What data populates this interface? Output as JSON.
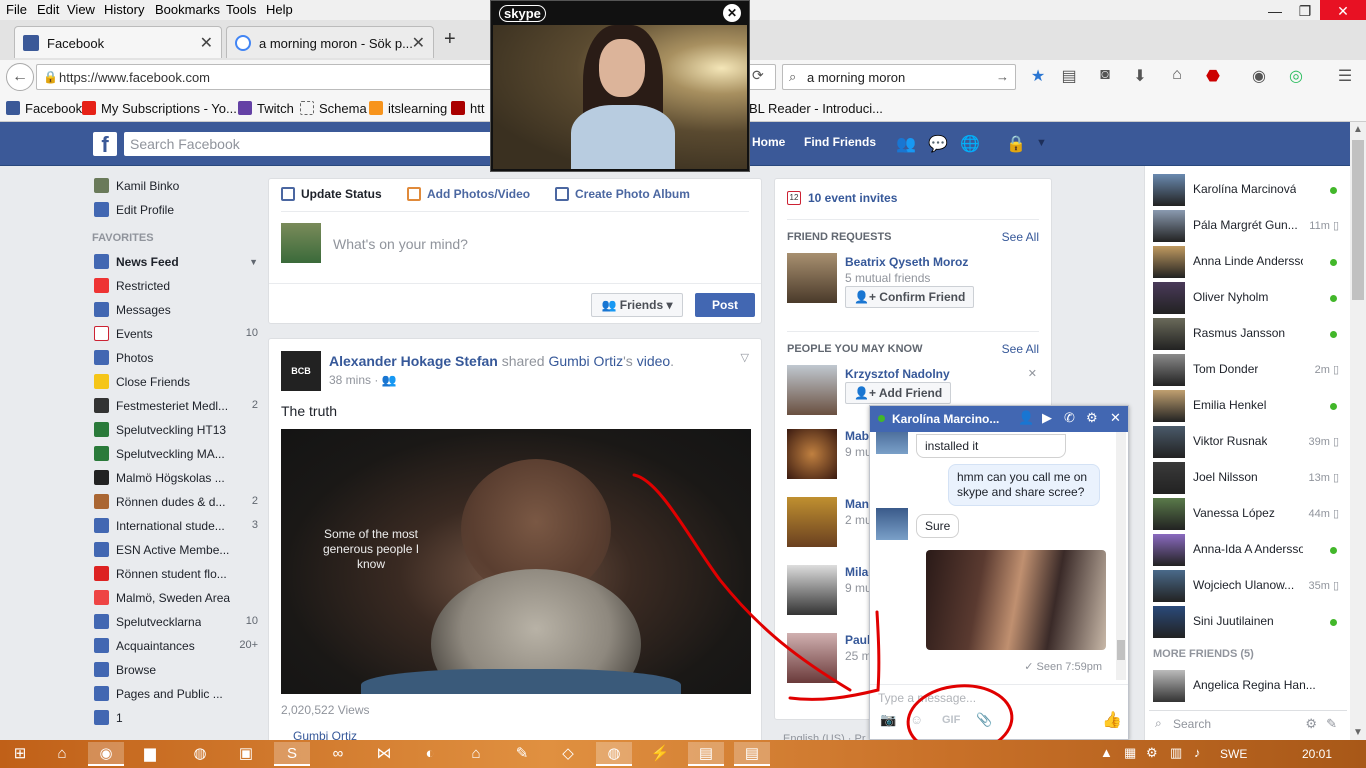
{
  "browser": {
    "menu": [
      "File",
      "Edit",
      "View",
      "History",
      "Bookmarks",
      "Tools",
      "Help"
    ],
    "tabs": [
      {
        "label": "Facebook",
        "active": true
      },
      {
        "label": "a morning moron - Sök p...",
        "active": false
      }
    ],
    "url": "https://www.facebook.com",
    "search_query": "a morning moron",
    "bookmarks": [
      "Facebook",
      "My Subscriptions - Yo...",
      "Twitch",
      "Schema",
      "itslearning",
      "htt",
      "BL Reader - Introduci..."
    ]
  },
  "skype": {
    "logo": "skype",
    "close": "✕"
  },
  "fb_header": {
    "search_placeholder": "Search Facebook",
    "home": "Home",
    "find_friends": "Find Friends"
  },
  "left_nav": {
    "user": "Kamil Binko",
    "edit_profile": "Edit Profile",
    "favorites_heading": "FAVORITES",
    "items": [
      {
        "label": "News Feed",
        "count": ""
      },
      {
        "label": "Restricted",
        "count": ""
      },
      {
        "label": "Messages",
        "count": ""
      },
      {
        "label": "Events",
        "count": "10"
      },
      {
        "label": "Photos",
        "count": ""
      },
      {
        "label": "Close Friends",
        "count": ""
      },
      {
        "label": "Festmesteriet Medl...",
        "count": "2"
      },
      {
        "label": "Spelutveckling HT13",
        "count": ""
      },
      {
        "label": "Spelutveckling MA...",
        "count": ""
      },
      {
        "label": "Malmö Högskolas ...",
        "count": ""
      },
      {
        "label": "Rönnen dudes & d...",
        "count": "2"
      },
      {
        "label": "International stude...",
        "count": "3"
      },
      {
        "label": "ESN Active Membe...",
        "count": ""
      },
      {
        "label": "Rönnen student flo...",
        "count": ""
      },
      {
        "label": "Malmö, Sweden Area",
        "count": ""
      },
      {
        "label": "Spelutvecklarna",
        "count": "10"
      },
      {
        "label": "Acquaintances",
        "count": "20+"
      },
      {
        "label": "Browse",
        "count": ""
      },
      {
        "label": "Pages and Public ...",
        "count": ""
      },
      {
        "label": "1",
        "count": ""
      }
    ]
  },
  "composer": {
    "update_status": "Update Status",
    "add_photos": "Add Photos/Video",
    "create_album": "Create Photo Album",
    "prompt": "What's on your mind?",
    "audience": "Friends",
    "post": "Post"
  },
  "post": {
    "author": "Alexander Hokage Stefan",
    "shared": "shared",
    "source": "Gumbi Ortiz",
    "source_suffix": "'s",
    "object": "video",
    "time": "38 mins",
    "text": "The truth",
    "video_caption": "Some of the most generous people I know",
    "avatar_text": "BCB",
    "views": "2,020,522 Views",
    "link": "Gumbi Ortiz"
  },
  "right_col": {
    "events": "10 event invites",
    "events_icon": "12",
    "friend_requests": "FRIEND REQUESTS",
    "see_all": "See All",
    "request": {
      "name": "Beatrix Qyseth Moroz",
      "meta": "5 mutual friends",
      "button": "Confirm Friend"
    },
    "pymk": "PEOPLE YOU MAY KNOW",
    "suggestions": [
      {
        "name": "Krzysztof Nadolny",
        "meta": "",
        "button": "Add Friend"
      },
      {
        "name": "Mab",
        "meta": "9 mu"
      },
      {
        "name": "Man",
        "meta": "2 mu"
      },
      {
        "name": "Milad",
        "meta": "9 mu"
      },
      {
        "name": "Paul",
        "meta": "25 m"
      }
    ],
    "footer": "English (US) · Pr"
  },
  "chat_list": {
    "friends": [
      {
        "name": "Karolína Marcinová",
        "status": "online",
        "time": ""
      },
      {
        "name": "Pála Margrét Gun...",
        "status": "mobile",
        "time": "11m"
      },
      {
        "name": "Anna Linde Andersson",
        "status": "online",
        "time": ""
      },
      {
        "name": "Oliver Nyholm",
        "status": "online",
        "time": ""
      },
      {
        "name": "Rasmus Jansson",
        "status": "online",
        "time": ""
      },
      {
        "name": "Tom Donder",
        "status": "mobile",
        "time": "2m"
      },
      {
        "name": "Emilia Henkel",
        "status": "online",
        "time": ""
      },
      {
        "name": "Viktor Rusnak",
        "status": "mobile",
        "time": "39m"
      },
      {
        "name": "Joel Nilsson",
        "status": "mobile",
        "time": "13m"
      },
      {
        "name": "Vanessa López",
        "status": "mobile",
        "time": "44m"
      },
      {
        "name": "Anna-Ida A Andersson",
        "status": "online",
        "time": ""
      },
      {
        "name": "Wojciech Ulanow...",
        "status": "mobile",
        "time": "35m"
      },
      {
        "name": "Sini Juutilainen",
        "status": "online",
        "time": ""
      }
    ],
    "more_heading": "MORE FRIENDS (5)",
    "more": [
      {
        "name": "Angelica Regina Han..."
      }
    ],
    "search_placeholder": "Search"
  },
  "chat_window": {
    "name": "Karolína Marcino...",
    "messages": [
      {
        "from": "them",
        "text": "installed it"
      },
      {
        "from": "me",
        "text": "hmm can you call me on skype and share scree?"
      },
      {
        "from": "them",
        "text": "Sure"
      }
    ],
    "seen": "✓ Seen 7:59pm",
    "input_placeholder": "Type a message...",
    "gif_label": "GIF"
  },
  "taskbar": {
    "language": "SWE",
    "clock": "20:01"
  },
  "colors": {
    "fb_blue": "#3b5998",
    "online": "#42b72a",
    "annotation": "#e00000"
  }
}
